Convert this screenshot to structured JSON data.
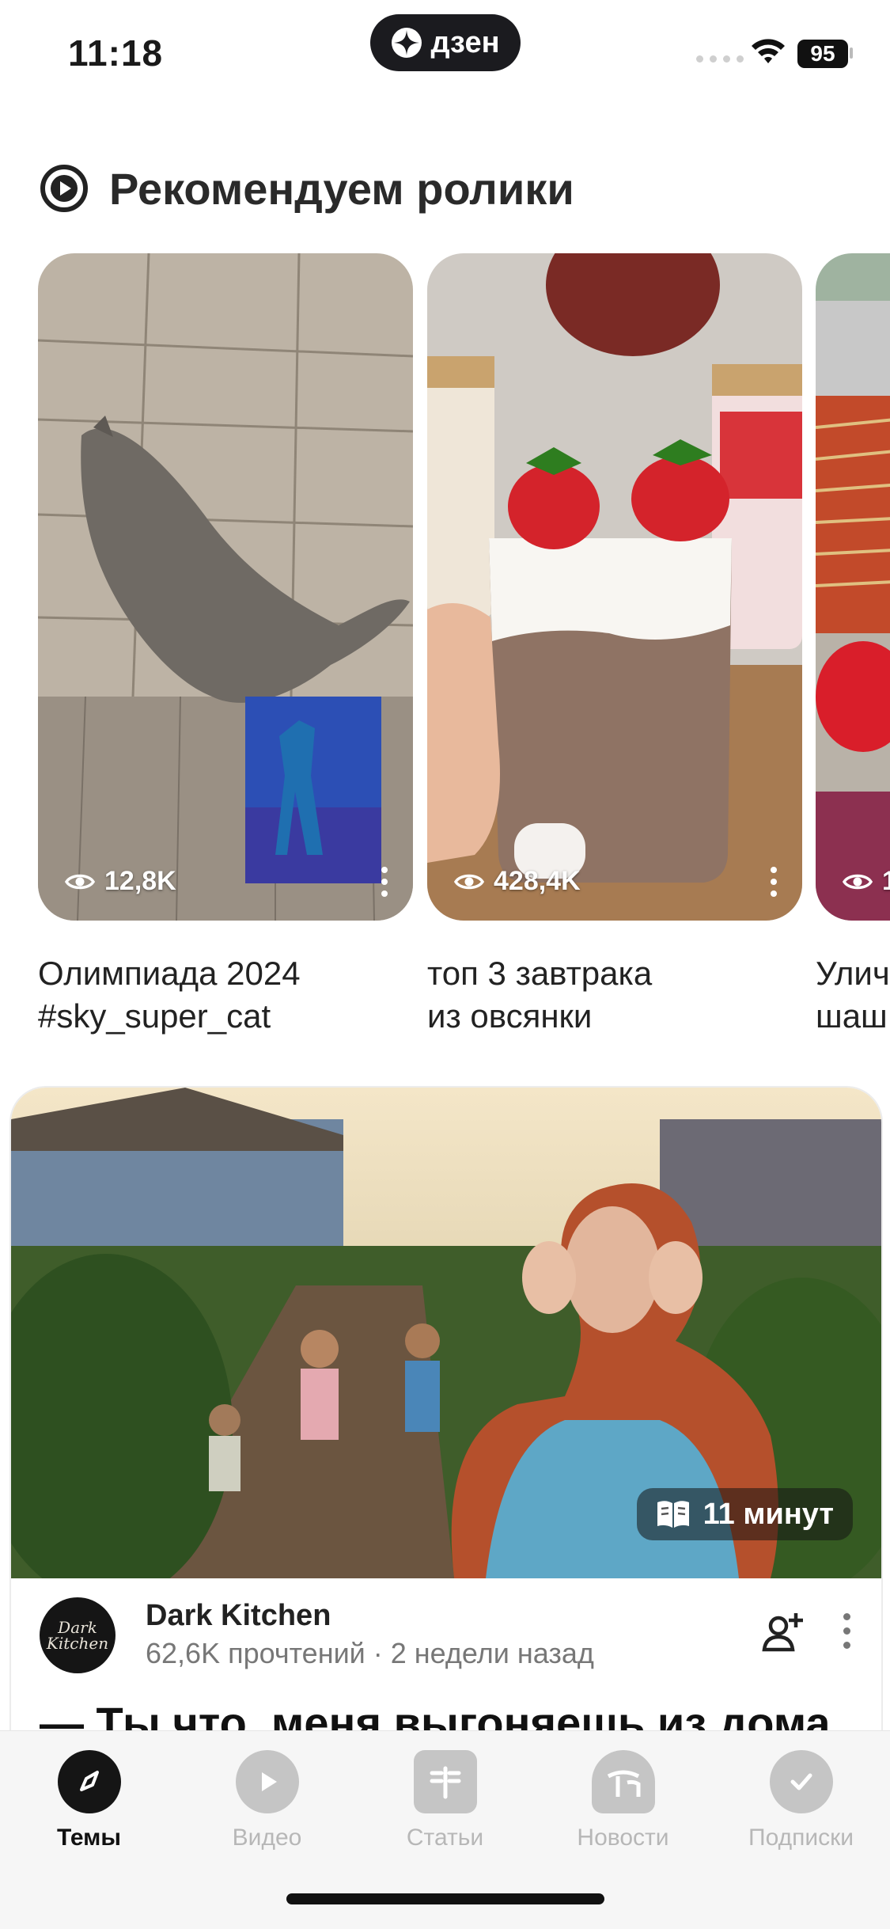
{
  "status_bar": {
    "time": "11:18",
    "brand": "дзен",
    "battery": "95"
  },
  "section": {
    "title": "Рекомендуем ролики"
  },
  "videos": [
    {
      "views": "12,8K",
      "caption": "Олимпиада 2024\n#sky_super_cat"
    },
    {
      "views": "428,4K",
      "caption": "топ 3 завтрака\nиз овсянки"
    },
    {
      "views": "1",
      "caption": "Улич\nшаш"
    }
  ],
  "article": {
    "read_time": "11 минут",
    "author": "Dark Kitchen",
    "avatar_text": "Dark Kitchen",
    "meta": "62,6K прочтений · 2 недели назад",
    "headline": "— Ты что, меня выгоняешь из дома"
  },
  "tabs": [
    {
      "label": "Темы",
      "icon": "compass-icon",
      "active": true
    },
    {
      "label": "Видео",
      "icon": "play-icon"
    },
    {
      "label": "Статьи",
      "icon": "article-icon"
    },
    {
      "label": "Новости",
      "icon": "news-icon"
    },
    {
      "label": "Подписки",
      "icon": "check-icon"
    }
  ]
}
